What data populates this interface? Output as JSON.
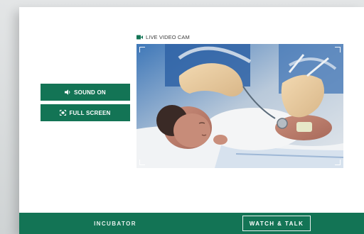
{
  "camera": {
    "label": "LIVE VIDEO CAM",
    "icon": "video-camera-icon",
    "accent_color": "#137455"
  },
  "controls": {
    "sound_label": "SOUND ON",
    "sound_icon": "speaker-icon",
    "fullscreen_label": "FULL SCREEN",
    "fullscreen_icon": "expand-icon"
  },
  "footer": {
    "tabs": [
      {
        "label": "INCUBATOR"
      },
      {
        "label": "WATCH & TALK"
      }
    ],
    "background_color": "#137455"
  }
}
